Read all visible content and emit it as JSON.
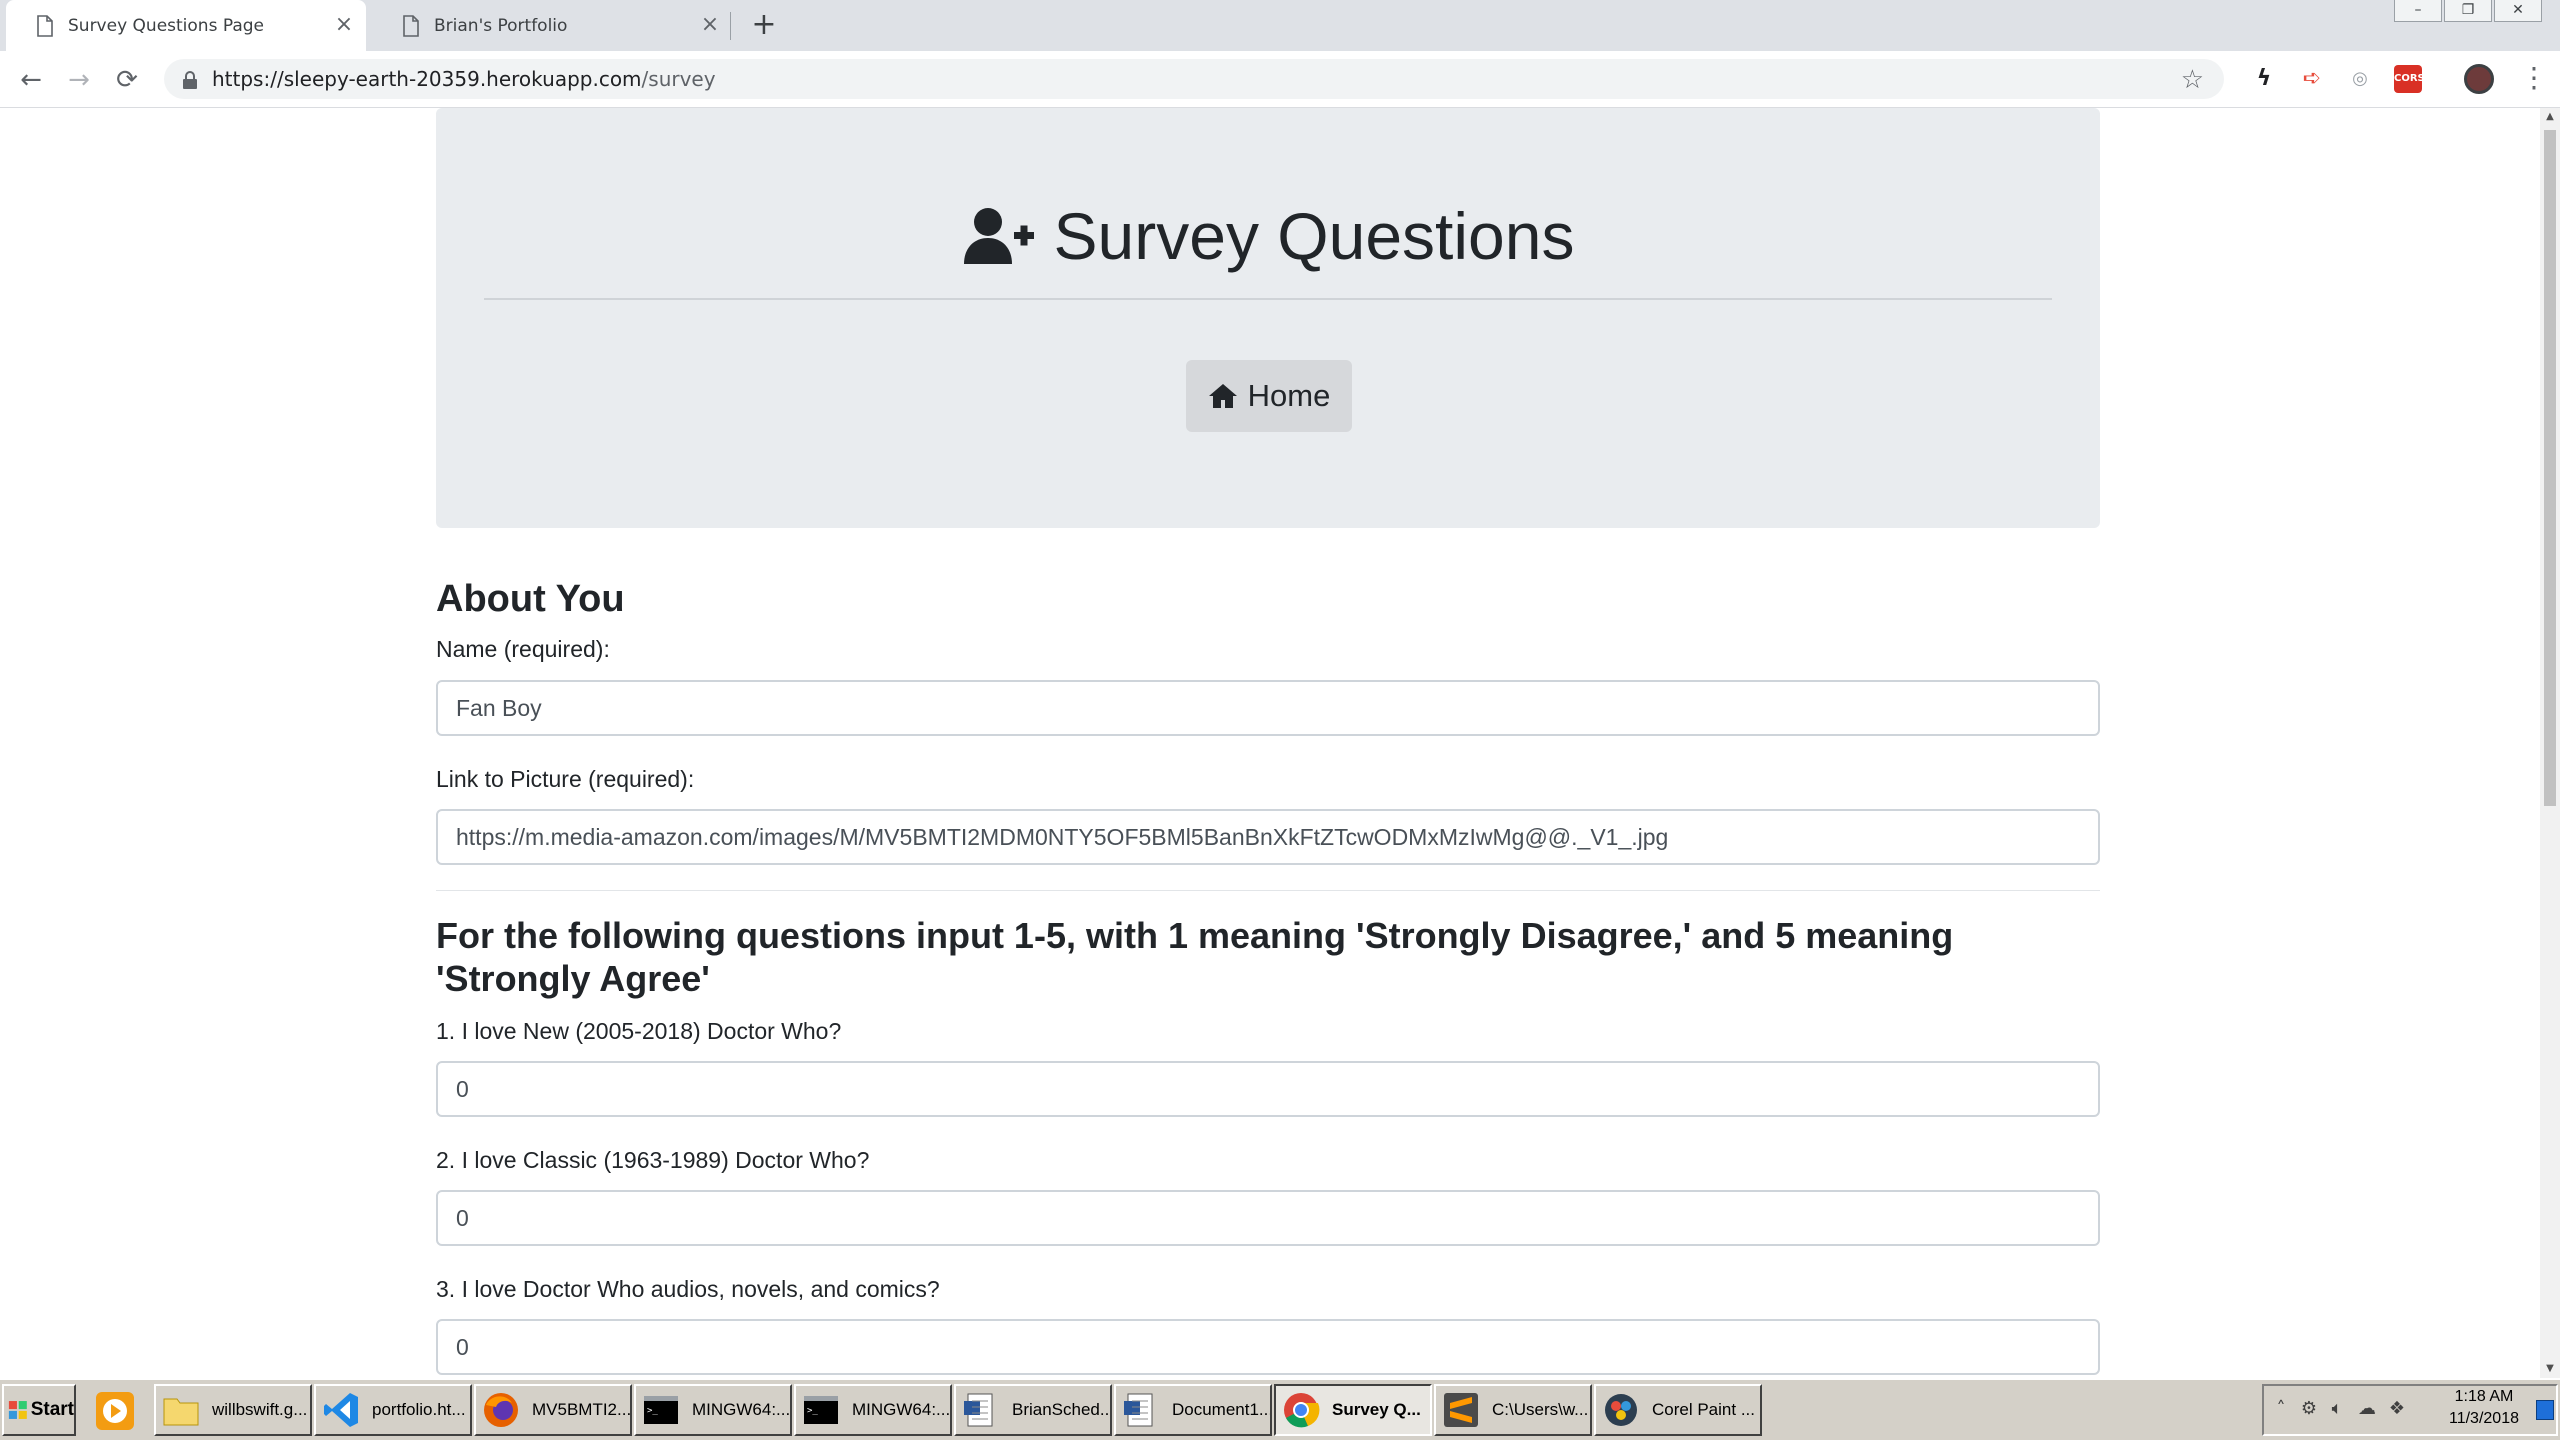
{
  "browser": {
    "tabs": [
      {
        "title": "Survey Questions Page",
        "active": true
      },
      {
        "title": "Brian's Portfolio",
        "active": false
      }
    ],
    "url_domain": "https://sleepy-earth-20359.herokuapp.com",
    "url_path": "/survey"
  },
  "page": {
    "title": "Survey Questions",
    "home_label": "Home",
    "about_heading": "About You",
    "name_label": "Name (required):",
    "name_value": "Fan Boy",
    "picture_label": "Link to Picture (required):",
    "picture_value": "https://m.media-amazon.com/images/M/MV5BMTI2MDM0NTY5OF5BMl5BanBnXkFtZTcwODMxMzIwMg@@._V1_.jpg",
    "instructions": "For the following questions input 1-5, with 1 meaning 'Strongly Disagree,' and 5 meaning 'Strongly Agree'",
    "questions": [
      {
        "label": "1. I love New (2005-2018) Doctor Who?",
        "value": "0"
      },
      {
        "label": "2. I love Classic (1963-1989) Doctor Who?",
        "value": "0"
      },
      {
        "label": "3. I love Doctor Who audios, novels, and comics?",
        "value": "0"
      }
    ]
  },
  "taskbar": {
    "start_label": "Start",
    "tasks": [
      {
        "label": "willbswift.g...",
        "icon": "folder-icon"
      },
      {
        "label": "portfolio.ht...",
        "icon": "vscode-icon"
      },
      {
        "label": "MV5BMTI2...",
        "icon": "firefox-icon"
      },
      {
        "label": "MINGW64:...",
        "icon": "terminal-icon"
      },
      {
        "label": "MINGW64:...",
        "icon": "terminal-icon"
      },
      {
        "label": "BrianSched...",
        "icon": "document-icon"
      },
      {
        "label": "Document1...",
        "icon": "document-icon"
      },
      {
        "label": "Survey Q...",
        "icon": "chrome-icon",
        "active": true
      },
      {
        "label": "C:\\Users\\w...",
        "icon": "sublime-icon"
      },
      {
        "label": "Corel Paint ...",
        "icon": "corel-icon"
      }
    ],
    "clock_time": "1:18 AM",
    "clock_date": "11/3/2018"
  },
  "colors": {
    "jumbotron_bg": "#e9ecef",
    "home_button_bg": "#d6d8db",
    "taskbar_bg": "#d4d0c8"
  }
}
